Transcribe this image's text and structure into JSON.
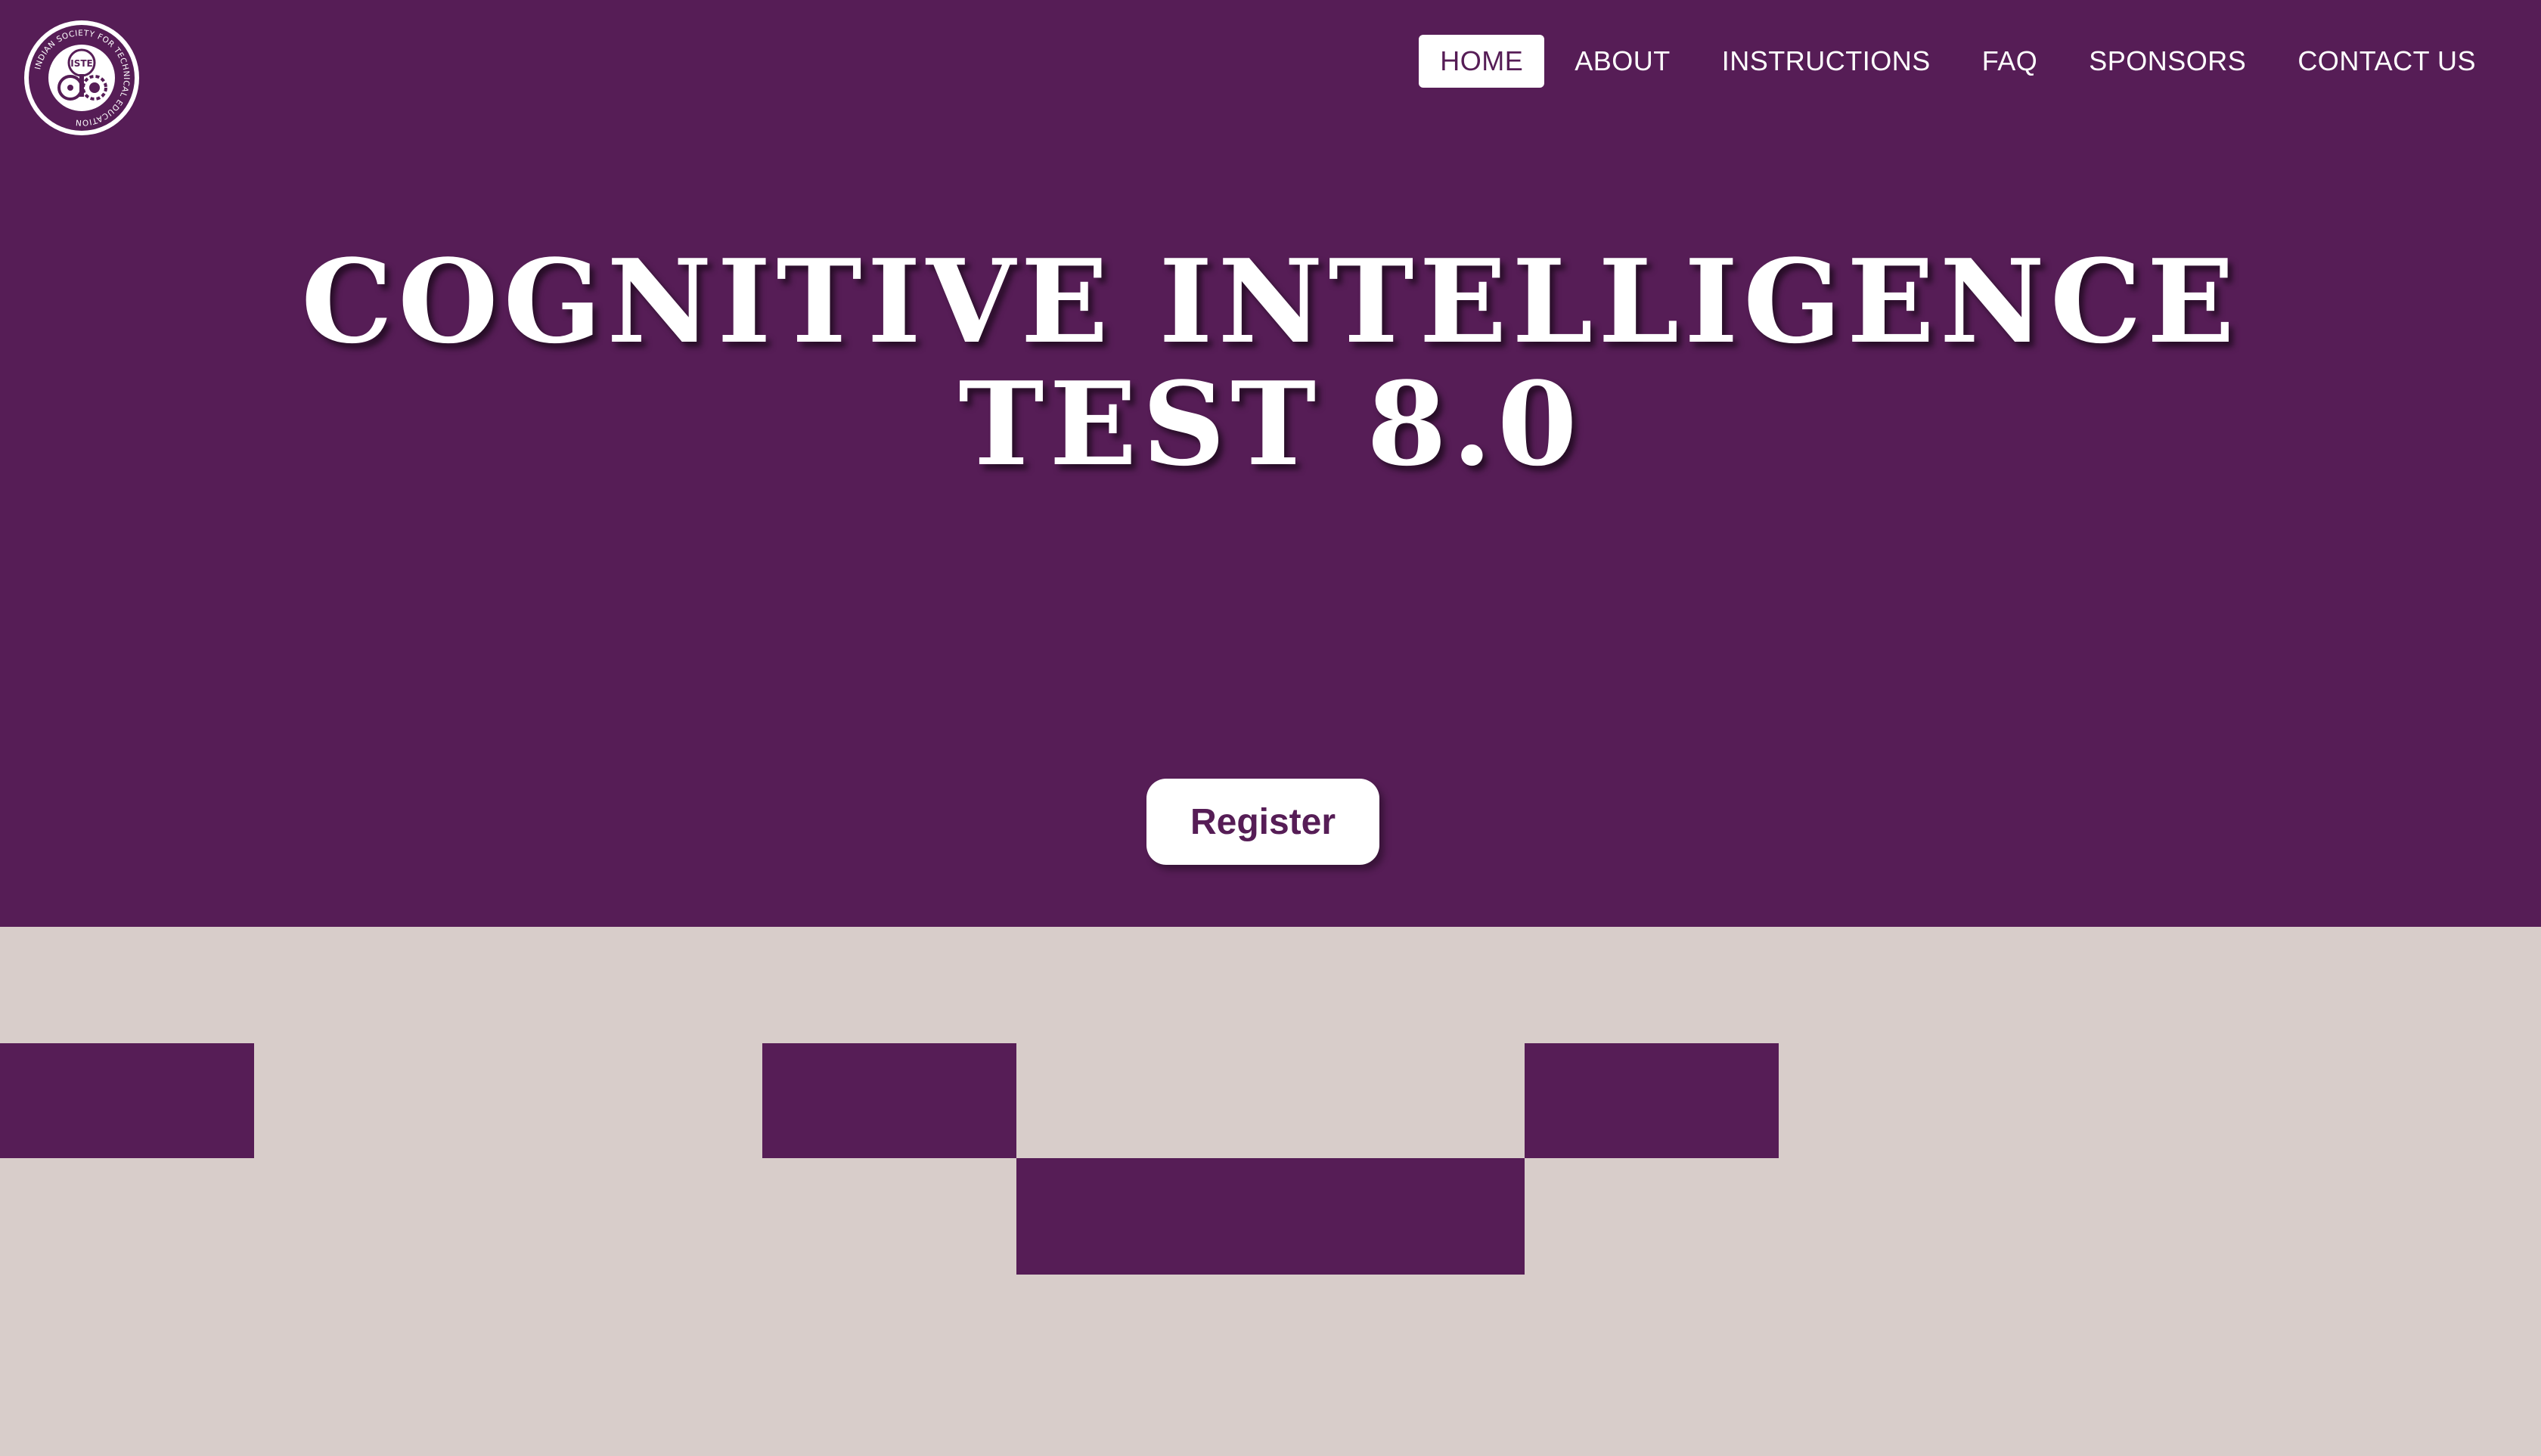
{
  "header": {
    "logo": {
      "icon": "iste-logo-icon",
      "ring_text": "INDIAN SOCIETY FOR TECHNICAL EDUCATION",
      "center_text": "ISTE"
    },
    "nav": [
      {
        "label": "HOME",
        "active": true
      },
      {
        "label": "ABOUT",
        "active": false
      },
      {
        "label": "INSTRUCTIONS",
        "active": false
      },
      {
        "label": "FAQ",
        "active": false
      },
      {
        "label": "SPONSORS",
        "active": false
      },
      {
        "label": "CONTACT US",
        "active": false
      }
    ]
  },
  "hero": {
    "title_line1": "COGNITIVE INTELLIGENCE",
    "title_line2": "TEST 8.0",
    "register_label": "Register"
  },
  "theme": {
    "primary": "#561d56",
    "secondary": "#d8cdca",
    "text_light": "#ffffff"
  }
}
